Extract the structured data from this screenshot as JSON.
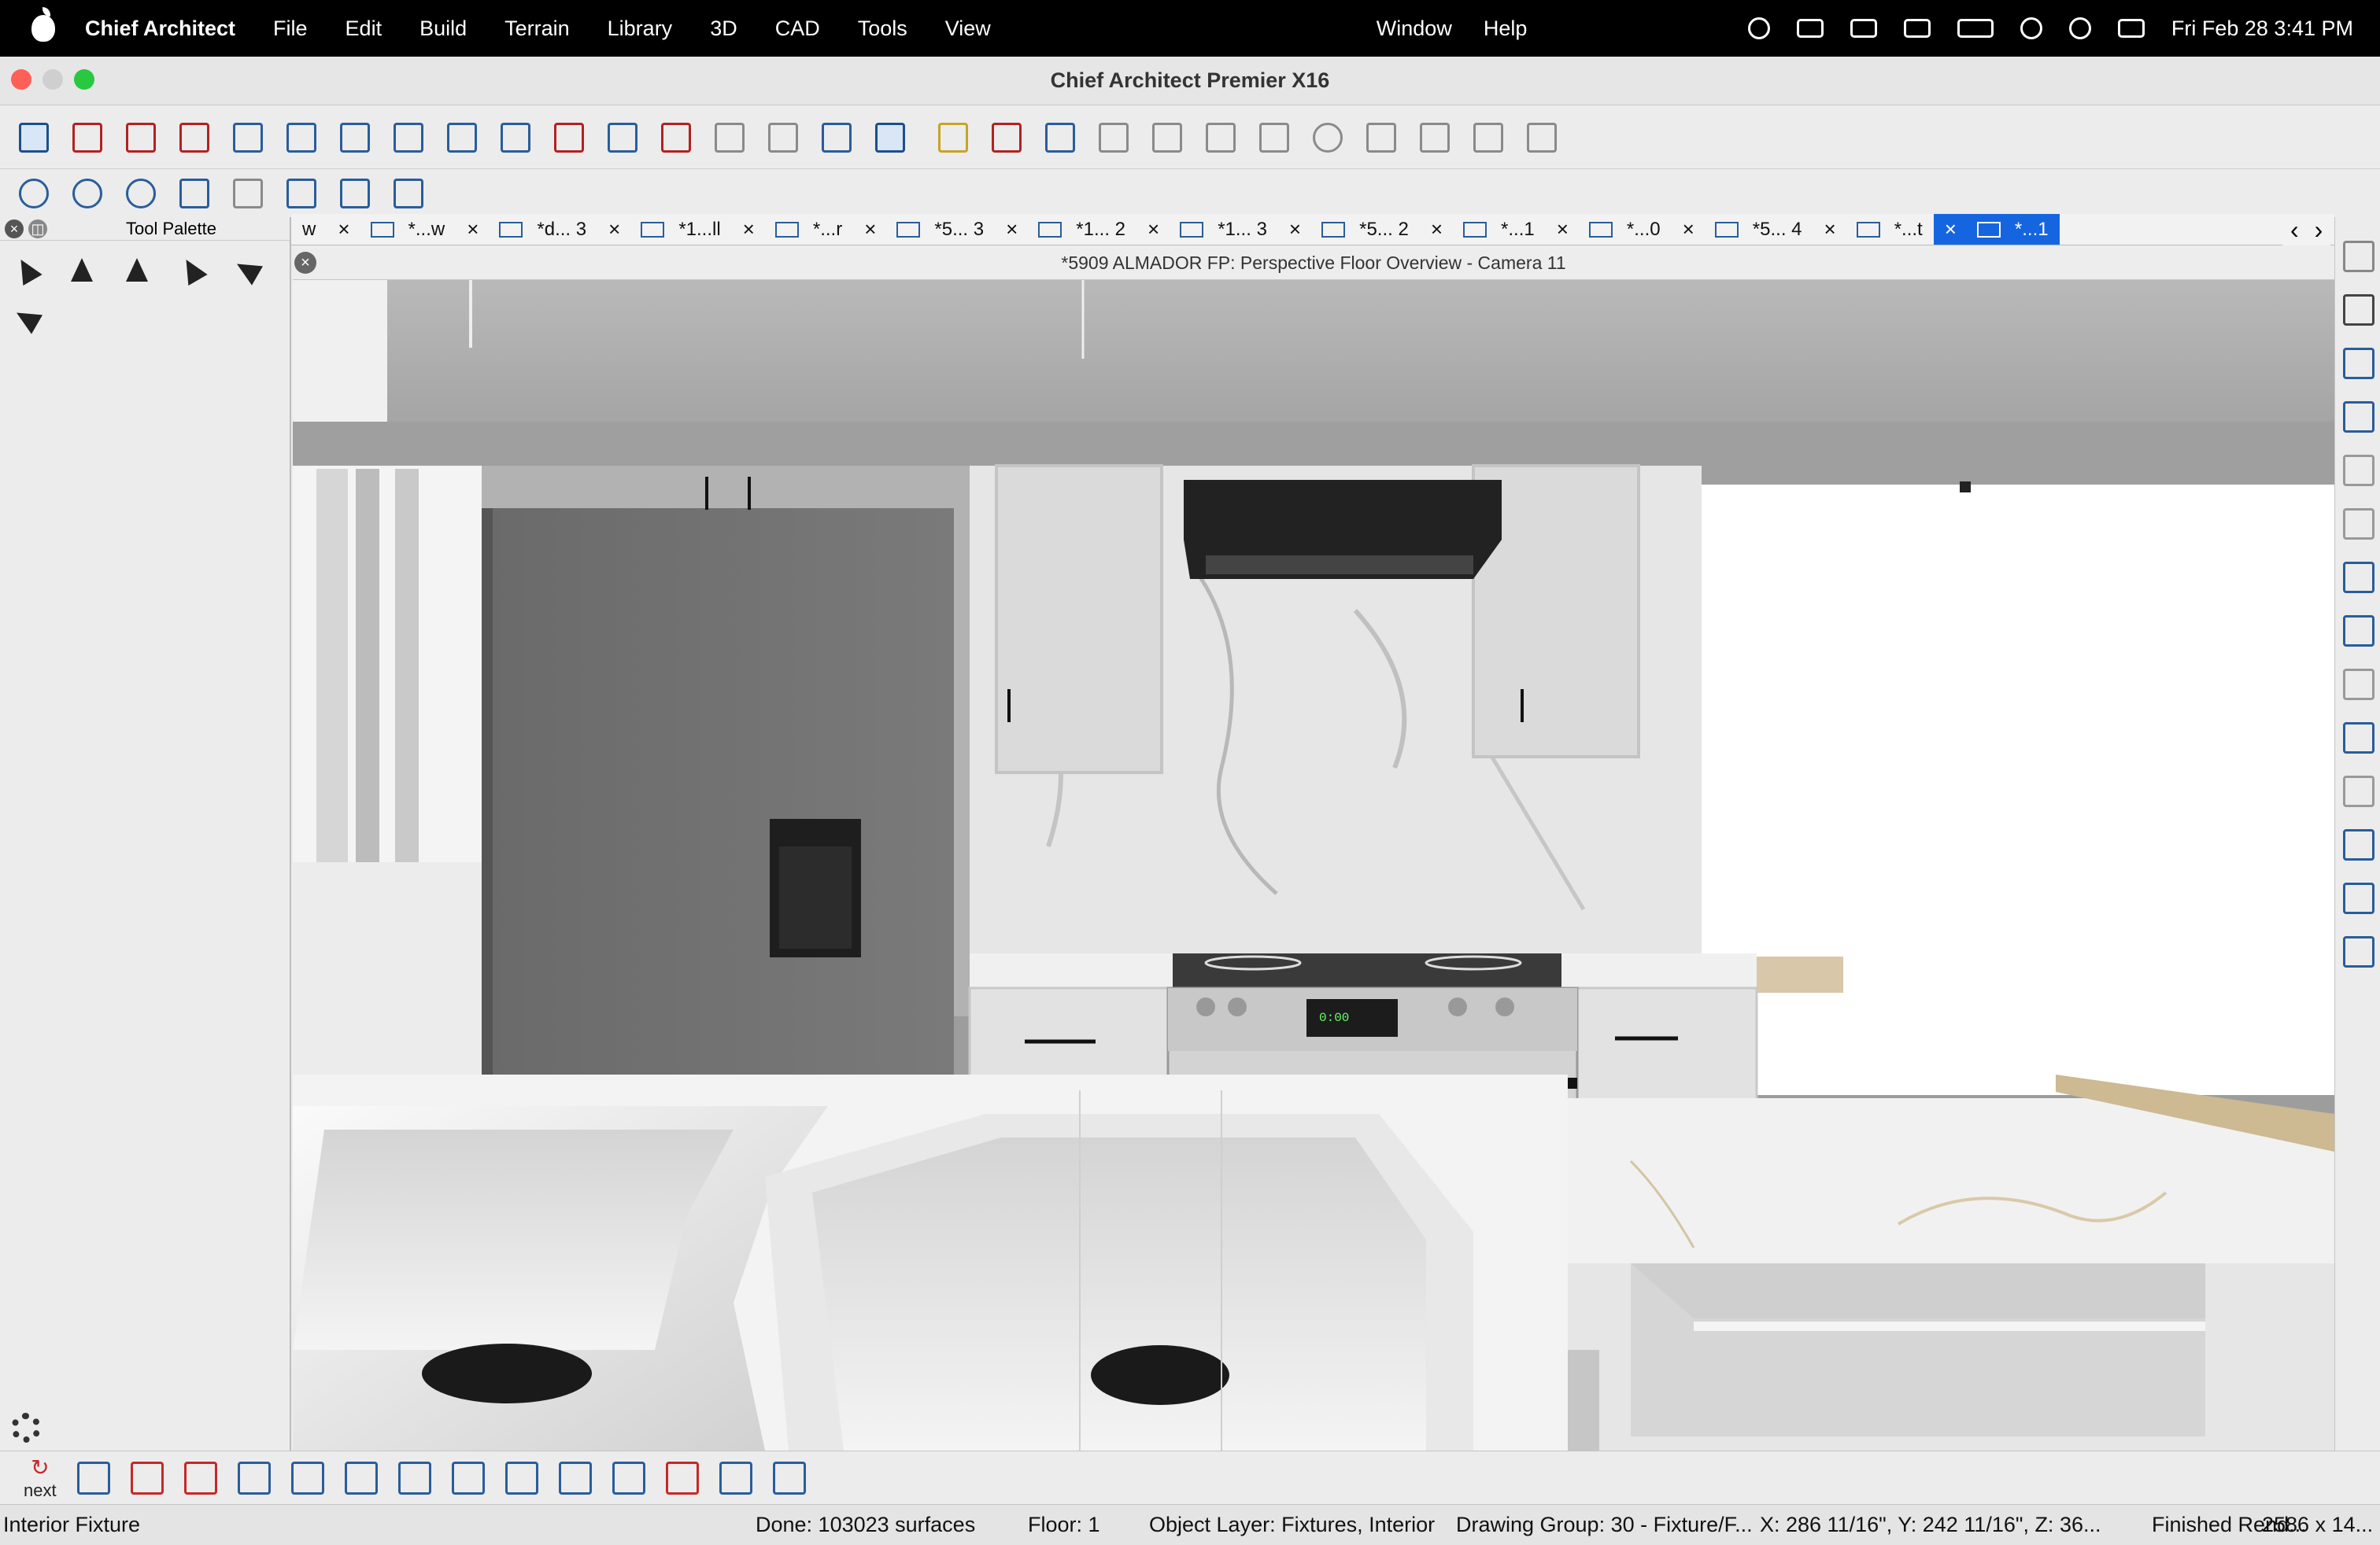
{
  "menubar": {
    "app_name": "Chief Architect",
    "items": [
      "File",
      "Edit",
      "Build",
      "Terrain",
      "Library",
      "3D",
      "CAD",
      "Tools",
      "View"
    ],
    "right_items": [
      "Window",
      "Help"
    ],
    "clock": "Fri Feb 28  3:41 PM"
  },
  "window": {
    "title": "Chief Architect Premier X16"
  },
  "tabs": [
    {
      "label": "w"
    },
    {
      "label": "*...w"
    },
    {
      "label": "*d... 3"
    },
    {
      "label": "*1...ll"
    },
    {
      "label": "*...r"
    },
    {
      "label": "*5... 3"
    },
    {
      "label": "*1... 2"
    },
    {
      "label": "*1... 3"
    },
    {
      "label": "*5... 2"
    },
    {
      "label": "*...1"
    },
    {
      "label": "*...0"
    },
    {
      "label": "*5... 4"
    },
    {
      "label": "*...t"
    },
    {
      "label": "*...1"
    }
  ],
  "palette": {
    "title": "Tool Palette"
  },
  "view": {
    "title": "*5909 ALMADOR FP: Perspective Floor Overview - Camera 11",
    "range_display": "0:00"
  },
  "bottom": {
    "next_label": "next"
  },
  "status": {
    "object": "Interior Fixture",
    "done": "Done:  103023 surfaces",
    "floor": "Floor: 1",
    "layer": "Object Layer: Fixtures, Interior",
    "group": "Drawing Group: 30 - Fixture/F...",
    "coords": "X: 286 11/16\", Y: 242 11/16\", Z: 36...",
    "render": "Finished Rend...",
    "size": "2586 x 14..."
  },
  "colors": {
    "accent": "#1565e0",
    "menubar": "#000000",
    "icon_blue": "#2a5d9a"
  }
}
